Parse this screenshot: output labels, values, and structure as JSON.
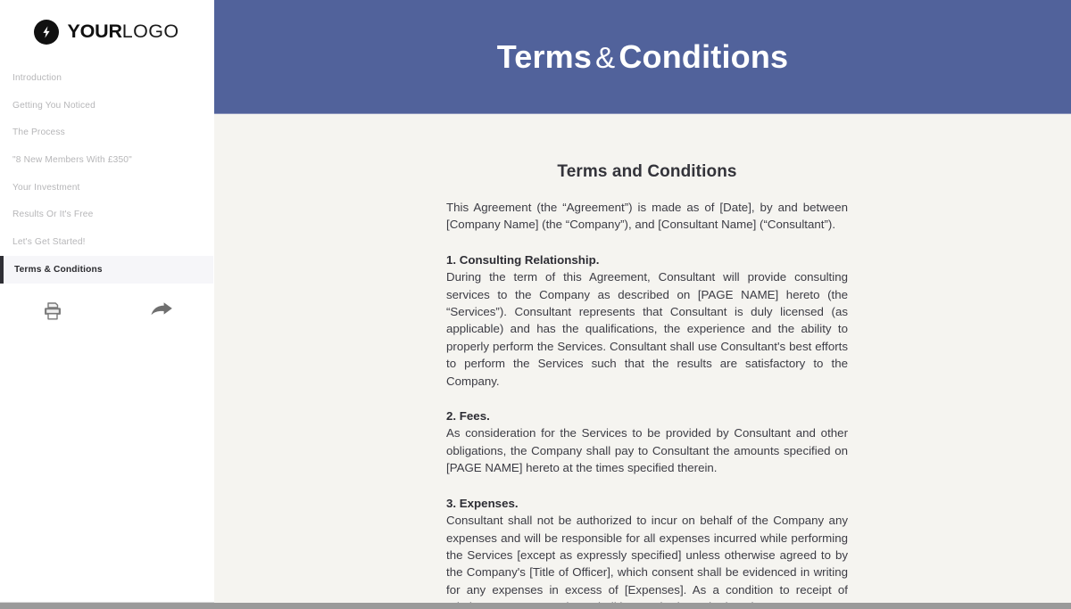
{
  "sidebar": {
    "logo": {
      "mark_icon": "lightning-bolt-icon",
      "bold_text": "YOUR",
      "light_text": "LOGO"
    },
    "items": [
      {
        "label": "Introduction",
        "active": false
      },
      {
        "label": "Getting You Noticed",
        "active": false
      },
      {
        "label": "The Process",
        "active": false
      },
      {
        "label": "\"8 New Members With £350\"",
        "active": false
      },
      {
        "label": "Your Investment",
        "active": false
      },
      {
        "label": "Results Or It's Free",
        "active": false
      },
      {
        "label": "Let's Get Started!",
        "active": false
      },
      {
        "label": "Terms & Conditions",
        "active": true
      }
    ],
    "tools": [
      {
        "name": "print-icon",
        "label": "Print"
      },
      {
        "name": "share-arrow-icon",
        "label": "Share"
      }
    ]
  },
  "header": {
    "title_part1": "Terms",
    "title_amp": "&",
    "title_part2": "Conditions",
    "background_color": "#51629b"
  },
  "document": {
    "background_color": "#f5f4f0",
    "title": "Terms and Conditions",
    "blocks": [
      {
        "type": "paragraph",
        "text": "This Agreement (the “Agreement”) is made as of [Date], by and between [Company Name] (the “Company”), and [Consultant Name] (“Consultant”)."
      },
      {
        "type": "heading",
        "text": "1. Consulting Relationship."
      },
      {
        "type": "paragraph",
        "text": "During the term of this Agreement, Consultant will provide consulting services to the Company as described on [PAGE NAME] hereto (the “Services”).   Consultant represents that Consultant is duly licensed (as applicable) and has the qualifications, the experience and the ability to properly perform the Services. Consultant shall use Consultant's best efforts to perform the Services such that the results are satisfactory to the Company."
      },
      {
        "type": "heading",
        "text": "2. Fees."
      },
      {
        "type": "paragraph",
        "text": "As consideration for the Services to be provided by Consultant and other obligations, the Company shall pay to Consultant the amounts specified on [PAGE NAME] hereto at the times specified therein."
      },
      {
        "type": "heading",
        "text": "3. Expenses."
      },
      {
        "type": "paragraph",
        "text": "Consultant shall not be authorized to incur on behalf of the Company any expenses and will be responsible for all expenses incurred while performing the Services [except as expressly specified] unless otherwise agreed to by the Company's [Title of Officer], which consent shall be evidenced in writing for any expenses in excess of [Expenses]. As a condition to receipt of reimbursement, Consultant shall be required to submit to the Company"
      }
    ]
  }
}
